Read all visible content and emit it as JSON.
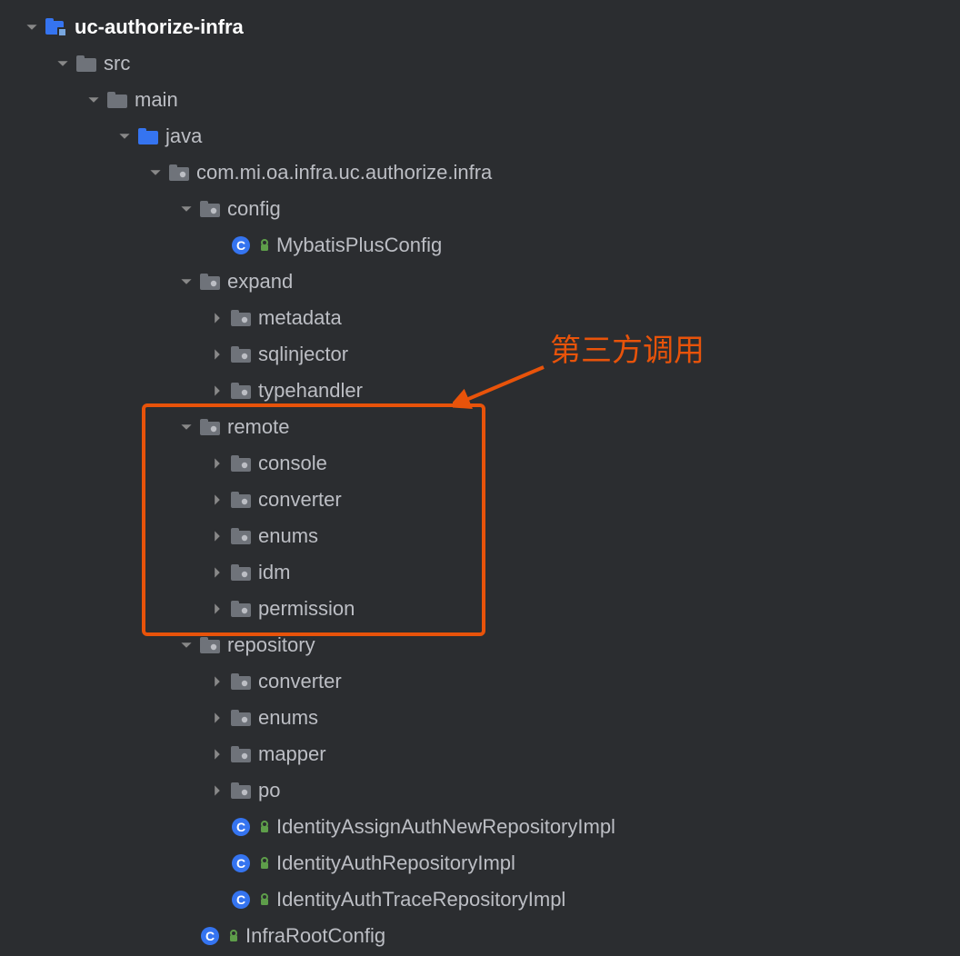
{
  "annotation": {
    "text": "第三方调用"
  },
  "tree": [
    {
      "indent": 0,
      "expanded": true,
      "type": "module",
      "label": "uc-authorize-infra",
      "bold": true
    },
    {
      "indent": 1,
      "expanded": true,
      "type": "folder",
      "label": "src"
    },
    {
      "indent": 2,
      "expanded": true,
      "type": "folder",
      "label": "main"
    },
    {
      "indent": 3,
      "expanded": true,
      "type": "source-folder",
      "label": "java"
    },
    {
      "indent": 4,
      "expanded": true,
      "type": "package",
      "label": "com.mi.oa.infra.uc.authorize.infra"
    },
    {
      "indent": 5,
      "expanded": true,
      "type": "package",
      "label": "config"
    },
    {
      "indent": 6,
      "expanded": null,
      "type": "class",
      "label": "MybatisPlusConfig",
      "hasModifier": true
    },
    {
      "indent": 5,
      "expanded": true,
      "type": "package",
      "label": "expand"
    },
    {
      "indent": 6,
      "expanded": false,
      "type": "package",
      "label": "metadata"
    },
    {
      "indent": 6,
      "expanded": false,
      "type": "package",
      "label": "sqlinjector"
    },
    {
      "indent": 6,
      "expanded": false,
      "type": "package",
      "label": "typehandler"
    },
    {
      "indent": 5,
      "expanded": true,
      "type": "package",
      "label": "remote"
    },
    {
      "indent": 6,
      "expanded": false,
      "type": "package",
      "label": "console"
    },
    {
      "indent": 6,
      "expanded": false,
      "type": "package",
      "label": "converter"
    },
    {
      "indent": 6,
      "expanded": false,
      "type": "package",
      "label": "enums"
    },
    {
      "indent": 6,
      "expanded": false,
      "type": "package",
      "label": "idm"
    },
    {
      "indent": 6,
      "expanded": false,
      "type": "package",
      "label": "permission"
    },
    {
      "indent": 5,
      "expanded": true,
      "type": "package",
      "label": "repository"
    },
    {
      "indent": 6,
      "expanded": false,
      "type": "package",
      "label": "converter"
    },
    {
      "indent": 6,
      "expanded": false,
      "type": "package",
      "label": "enums"
    },
    {
      "indent": 6,
      "expanded": false,
      "type": "package",
      "label": "mapper"
    },
    {
      "indent": 6,
      "expanded": false,
      "type": "package",
      "label": "po"
    },
    {
      "indent": 6,
      "expanded": null,
      "type": "class",
      "label": "IdentityAssignAuthNewRepositoryImpl",
      "hasModifier": true
    },
    {
      "indent": 6,
      "expanded": null,
      "type": "class",
      "label": "IdentityAuthRepositoryImpl",
      "hasModifier": true
    },
    {
      "indent": 6,
      "expanded": null,
      "type": "class",
      "label": "IdentityAuthTraceRepositoryImpl",
      "hasModifier": true
    },
    {
      "indent": 5,
      "expanded": null,
      "type": "class",
      "label": "InfraRootConfig",
      "hasModifier": true
    }
  ]
}
